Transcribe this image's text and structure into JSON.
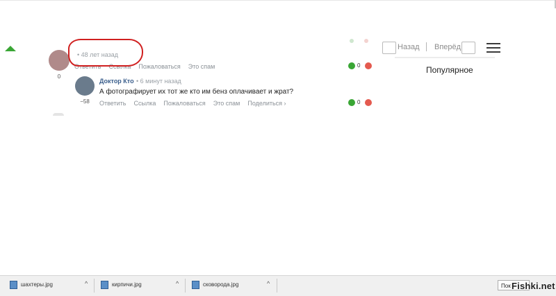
{
  "comments": [
    {
      "rating": "0",
      "time": "• 48 лет назад",
      "actions": [
        "Ответить",
        "Ссылка",
        "Пожаловаться",
        "Это спам"
      ],
      "votes": "0"
    },
    {
      "author": "Доктор Кто",
      "time": "• 6 минут назад",
      "text": "А фотографирует их тот же кто им бенз оплачивает и жрат?",
      "rating": "−58",
      "actions": [
        "Ответить",
        "Ссылка",
        "Пожаловаться",
        "Это спам",
        "Поделиться ›"
      ],
      "votes": "0"
    }
  ],
  "nav": {
    "back_label": "Назад",
    "forward_label": "Вперёд",
    "popular_label": "Популярное"
  },
  "downloads": [
    {
      "name": "шахтеры.jpg",
      "icon": "image-file-icon"
    },
    {
      "name": "кирпичи.jpg",
      "icon": "image-file-icon"
    },
    {
      "name": "сковорода.jpg",
      "icon": "image-file-icon"
    }
  ],
  "downloads_bar": {
    "show_all_label": "Пок"
  },
  "watermark": "Fishki.net",
  "colors": {
    "upvote": "#3aa635",
    "downvote": "#e45a4f",
    "author_link": "#3a5e8c",
    "annotation": "#d02020"
  }
}
